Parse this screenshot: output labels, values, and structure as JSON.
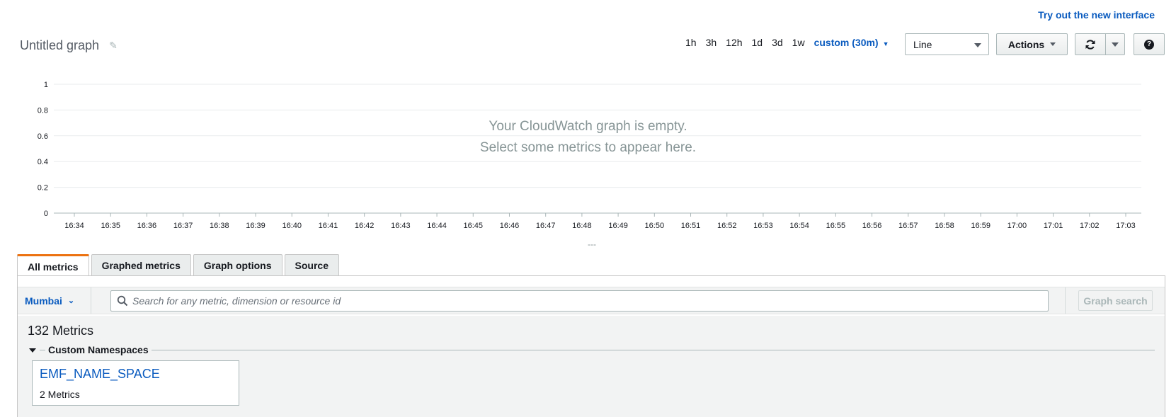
{
  "header": {
    "new_interface_link": "Try out the new interface",
    "graph_title": "Untitled graph"
  },
  "time_periods": [
    "1h",
    "3h",
    "12h",
    "1d",
    "3d",
    "1w"
  ],
  "custom_period": "custom (30m)",
  "graph_type": "Line",
  "actions_label": "Actions",
  "help_label": "?",
  "empty_message": {
    "line1": "Your CloudWatch graph is empty.",
    "line2": "Select some metrics to appear here."
  },
  "resize_handle": "---",
  "chart_data": {
    "type": "line",
    "y_ticks": [
      "0",
      "0.2",
      "0.4",
      "0.6",
      "0.8",
      "1"
    ],
    "ylim": [
      0,
      1
    ],
    "x_ticks": [
      "16:34",
      "16:35",
      "16:36",
      "16:37",
      "16:38",
      "16:39",
      "16:40",
      "16:41",
      "16:42",
      "16:43",
      "16:44",
      "16:45",
      "16:46",
      "16:47",
      "16:48",
      "16:49",
      "16:50",
      "16:51",
      "16:52",
      "16:53",
      "16:54",
      "16:55",
      "16:56",
      "16:57",
      "16:58",
      "16:59",
      "17:00",
      "17:01",
      "17:02",
      "17:03"
    ],
    "series": [],
    "grid": true
  },
  "tabs": [
    {
      "label": "All metrics",
      "active": true
    },
    {
      "label": "Graphed metrics",
      "active": false
    },
    {
      "label": "Graph options",
      "active": false
    },
    {
      "label": "Source",
      "active": false
    }
  ],
  "toolbar": {
    "region": "Mumbai",
    "search_placeholder": "Search for any metric, dimension or resource id",
    "graph_search_label": "Graph search"
  },
  "metrics": {
    "count_label": "132 Metrics",
    "namespace_group": "Custom Namespaces",
    "namespaces": [
      {
        "name": "EMF_NAME_SPACE",
        "count": "2 Metrics"
      }
    ]
  },
  "colors": {
    "link_blue": "#0a5bbf",
    "active_tab_accent": "#ec7211",
    "grid": "#e9ebed"
  }
}
